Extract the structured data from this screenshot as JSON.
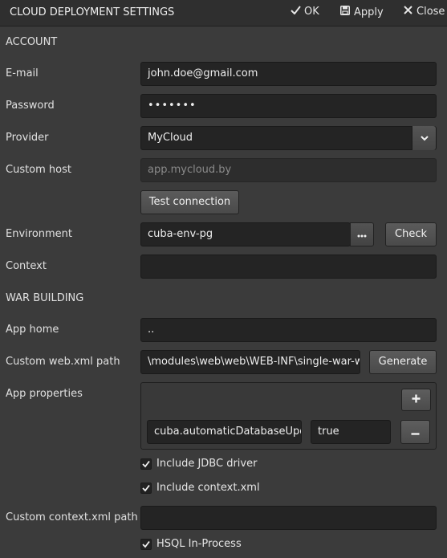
{
  "header": {
    "title": "CLOUD DEPLOYMENT SETTINGS",
    "ok_label": "OK",
    "apply_label": "Apply",
    "close_label": "Close"
  },
  "account": {
    "section_title": "ACCOUNT",
    "email_label": "E-mail",
    "email_value": "john.doe@gmail.com",
    "password_label": "Password",
    "password_value": "•••••••",
    "provider_label": "Provider",
    "provider_value": "MyCloud",
    "custom_host_label": "Custom host",
    "custom_host_placeholder": "app.mycloud.by",
    "test_connection_label": "Test connection",
    "environment_label": "Environment",
    "environment_value": "cuba-env-pg",
    "check_label": "Check",
    "context_label": "Context",
    "context_value": ""
  },
  "war_building": {
    "section_title": "WAR BUILDING",
    "app_home_label": "App home",
    "app_home_value": "..",
    "custom_webxml_label": "Custom web.xml path",
    "custom_webxml_value": "\\modules\\web\\web\\WEB-INF\\single-war-web.xml",
    "generate_label": "Generate",
    "app_properties_label": "App properties",
    "app_properties": [
      {
        "key": "cuba.automaticDatabaseUpdate",
        "value": "true"
      }
    ],
    "include_jdbc_label": "Include JDBC driver",
    "include_jdbc_checked": true,
    "include_context_label": "Include context.xml",
    "include_context_checked": true,
    "custom_context_label": "Custom context.xml path",
    "custom_context_value": "",
    "hsql_label": "HSQL In-Process",
    "hsql_checked": true
  }
}
